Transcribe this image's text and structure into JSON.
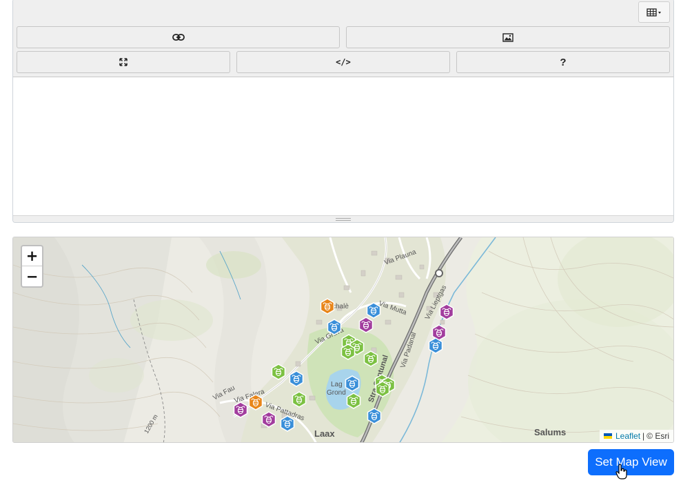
{
  "editor": {
    "toolbar": {
      "table_icon": "table-icon",
      "link_icon": "link-icon",
      "image_icon": "image-icon",
      "fullscreen_icon": "fullscreen-icon",
      "code_label": "</>",
      "help_label": "?"
    },
    "content": ""
  },
  "map": {
    "zoom_in": "+",
    "zoom_out": "−",
    "labels": {
      "laax": "Laax",
      "salums": "Salums",
      "lag_1": "Lag",
      "lag_2": "Grond",
      "via_plauna": "Via Plauna",
      "via_mutta": "Via Mutta",
      "via_grava": "Via Grava",
      "via_fau": "Via Fau",
      "via_falera": "Via Falera",
      "via_pattadras": "Via Pattadras",
      "via_padanal": "Via Padanal",
      "via_lieptgas": "Via Lieptgas",
      "stradun_cantunal": "Stra Cantunal",
      "schale": "schalè",
      "contour": "1200 m"
    },
    "marker_colors": {
      "blue": "#3a8fd9",
      "green": "#7cc142",
      "orange": "#e8861a",
      "purple": "#a23d9e"
    },
    "attribution": {
      "leaflet": "Leaflet",
      "separator": "|",
      "esri": "© Esri"
    }
  },
  "actions": {
    "set_map_view": "Set Map View"
  }
}
